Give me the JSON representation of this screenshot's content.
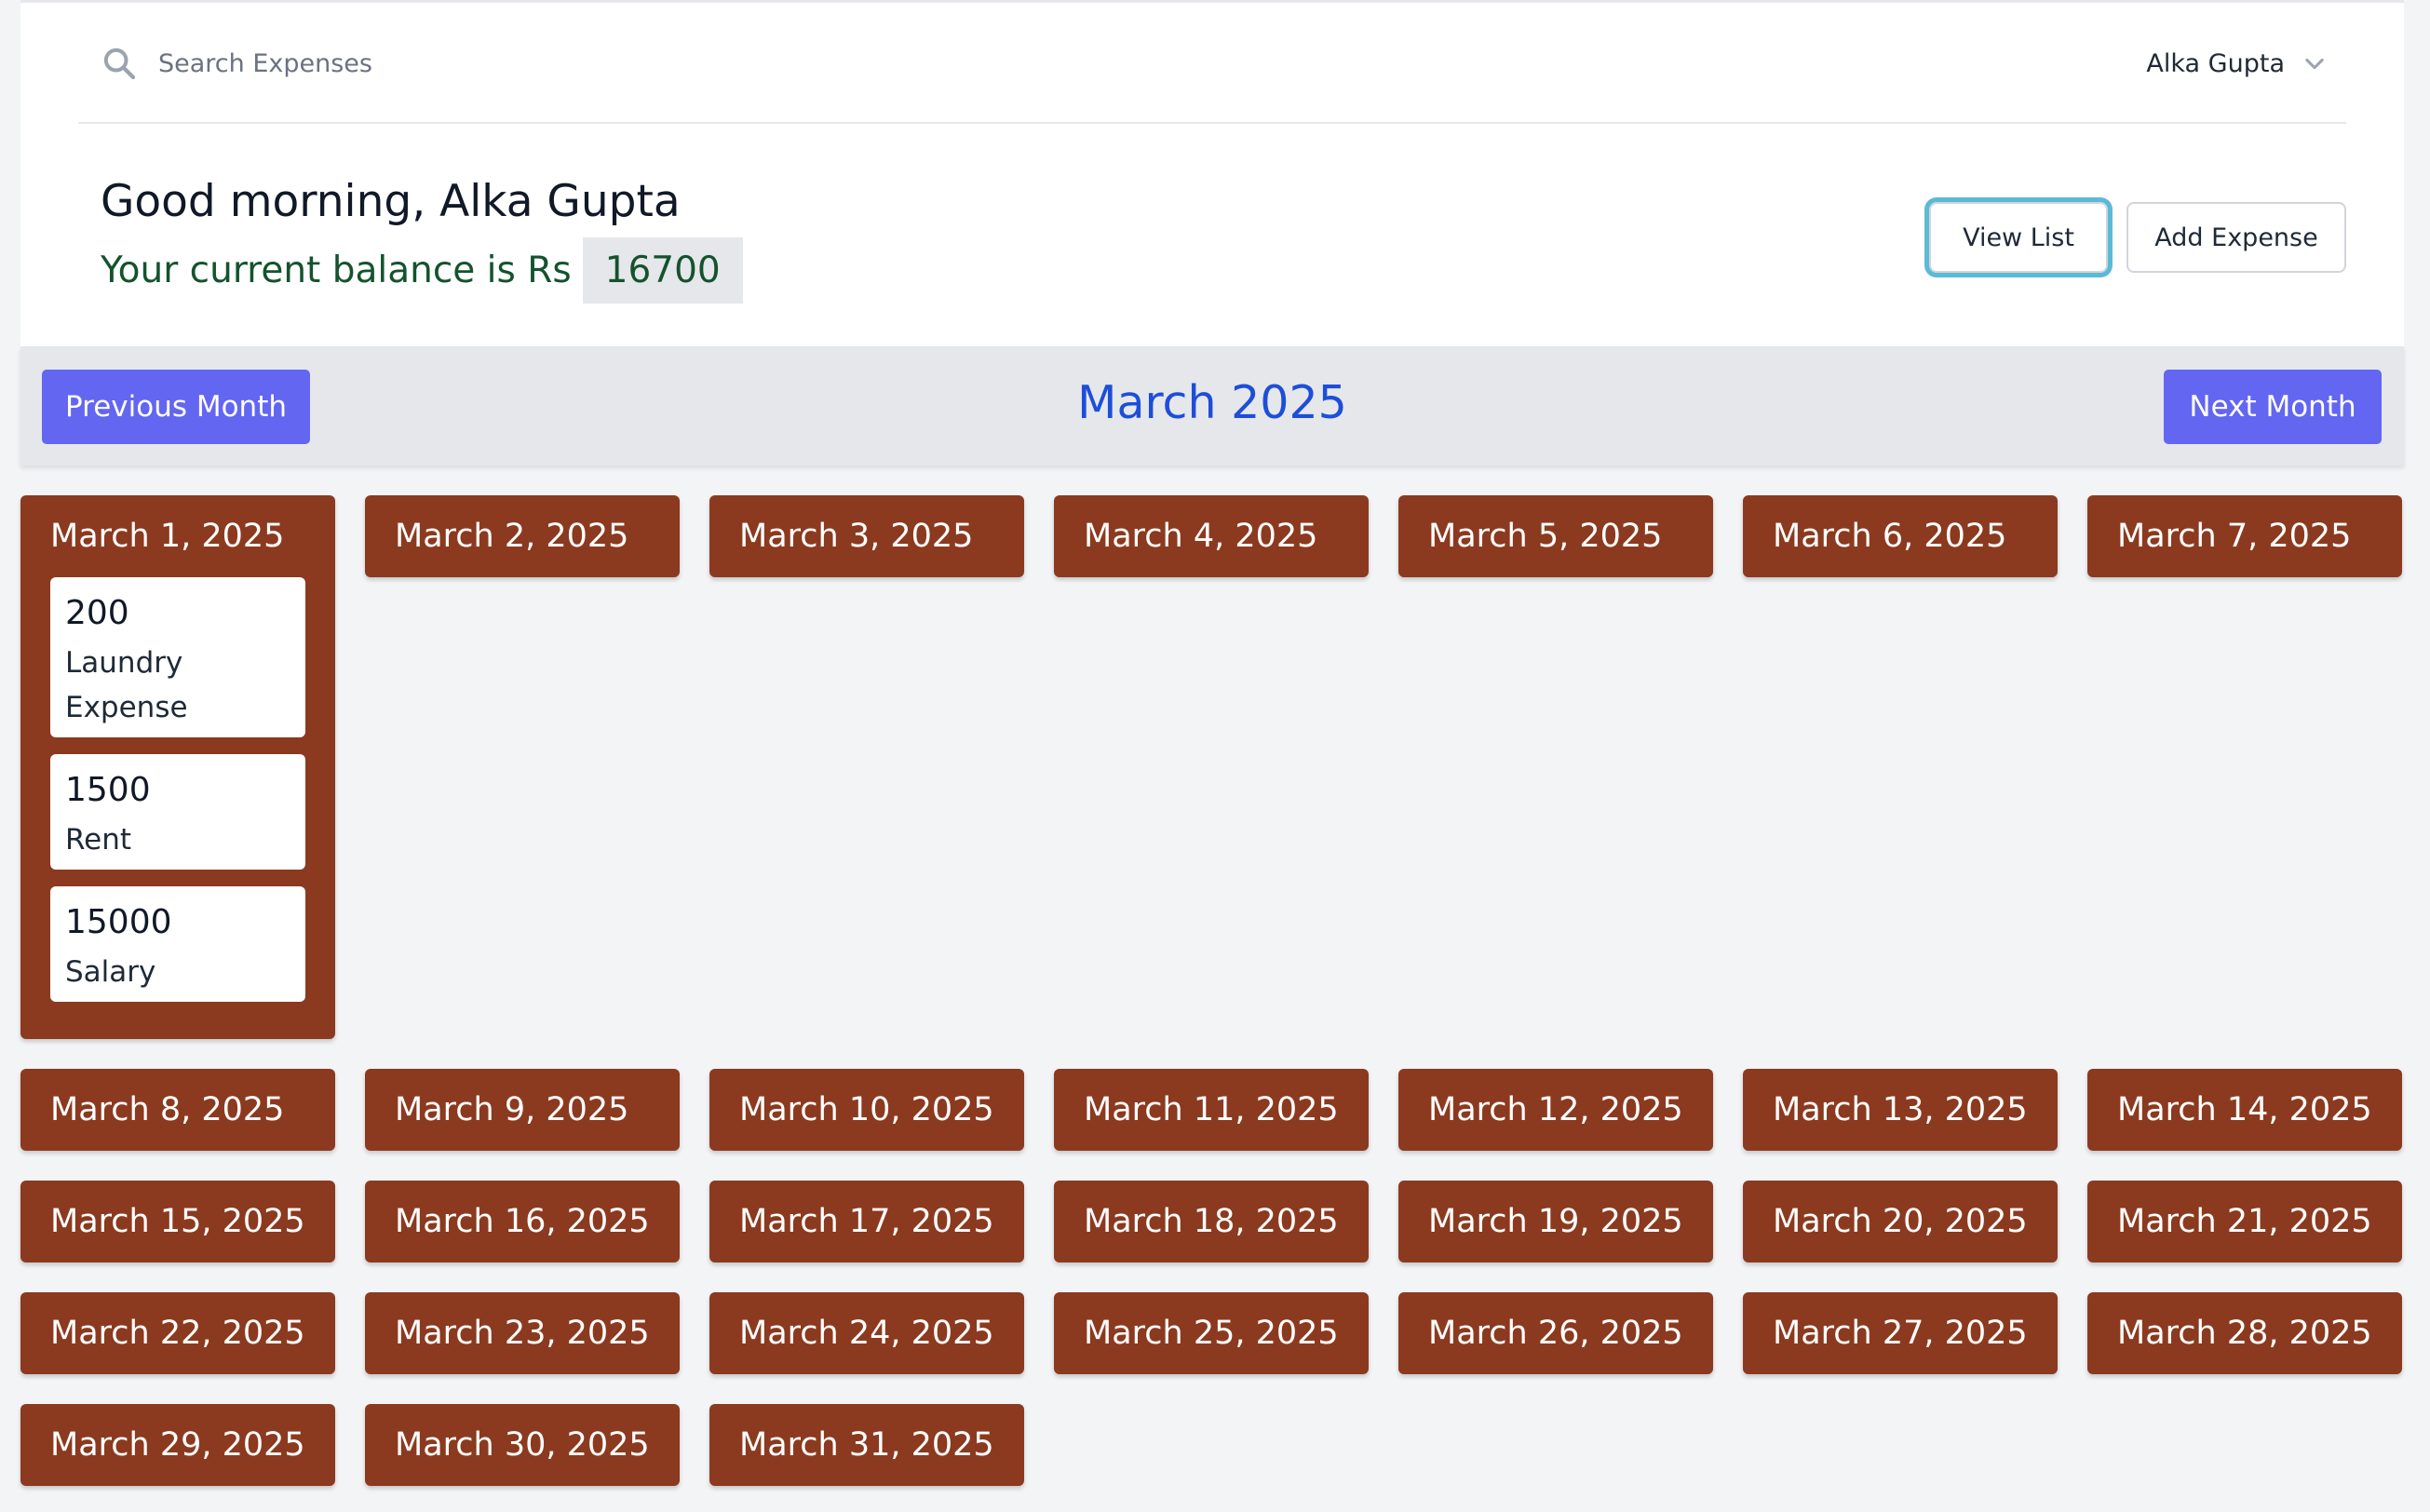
{
  "search": {
    "placeholder": "Search Expenses",
    "icon": "search-icon"
  },
  "user": {
    "name": "Alka Gupta",
    "icon": "chevron-down-icon"
  },
  "greeting": "Good morning, Alka Gupta",
  "balance": {
    "label": "Your current balance is Rs",
    "value": "16700"
  },
  "actions": {
    "view_list": "View List",
    "add_expense": "Add Expense"
  },
  "nav": {
    "previous": "Previous Month",
    "next": "Next Month",
    "current_month": "March 2025"
  },
  "colors": {
    "day_card": "#8b3a1f",
    "nav_button": "#6366f1",
    "month_title": "#1d4ed8",
    "balance_text": "#14532d"
  },
  "days": [
    {
      "label": "March 1, 2025",
      "expenses": [
        {
          "amount": "200",
          "description": "Laundry Expense"
        },
        {
          "amount": "1500",
          "description": "Rent"
        },
        {
          "amount": "15000",
          "description": "Salary"
        }
      ]
    },
    {
      "label": "March 2, 2025",
      "expenses": []
    },
    {
      "label": "March 3, 2025",
      "expenses": []
    },
    {
      "label": "March 4, 2025",
      "expenses": []
    },
    {
      "label": "March 5, 2025",
      "expenses": []
    },
    {
      "label": "March 6, 2025",
      "expenses": []
    },
    {
      "label": "March 7, 2025",
      "expenses": []
    },
    {
      "label": "March 8, 2025",
      "expenses": []
    },
    {
      "label": "March 9, 2025",
      "expenses": []
    },
    {
      "label": "March 10, 2025",
      "expenses": []
    },
    {
      "label": "March 11, 2025",
      "expenses": []
    },
    {
      "label": "March 12, 2025",
      "expenses": []
    },
    {
      "label": "March 13, 2025",
      "expenses": []
    },
    {
      "label": "March 14, 2025",
      "expenses": []
    },
    {
      "label": "March 15, 2025",
      "expenses": []
    },
    {
      "label": "March 16, 2025",
      "expenses": []
    },
    {
      "label": "March 17, 2025",
      "expenses": []
    },
    {
      "label": "March 18, 2025",
      "expenses": []
    },
    {
      "label": "March 19, 2025",
      "expenses": []
    },
    {
      "label": "March 20, 2025",
      "expenses": []
    },
    {
      "label": "March 21, 2025",
      "expenses": []
    },
    {
      "label": "March 22, 2025",
      "expenses": []
    },
    {
      "label": "March 23, 2025",
      "expenses": []
    },
    {
      "label": "March 24, 2025",
      "expenses": []
    },
    {
      "label": "March 25, 2025",
      "expenses": []
    },
    {
      "label": "March 26, 2025",
      "expenses": []
    },
    {
      "label": "March 27, 2025",
      "expenses": []
    },
    {
      "label": "March 28, 2025",
      "expenses": []
    },
    {
      "label": "March 29, 2025",
      "expenses": []
    },
    {
      "label": "March 30, 2025",
      "expenses": []
    },
    {
      "label": "March 31, 2025",
      "expenses": []
    }
  ]
}
